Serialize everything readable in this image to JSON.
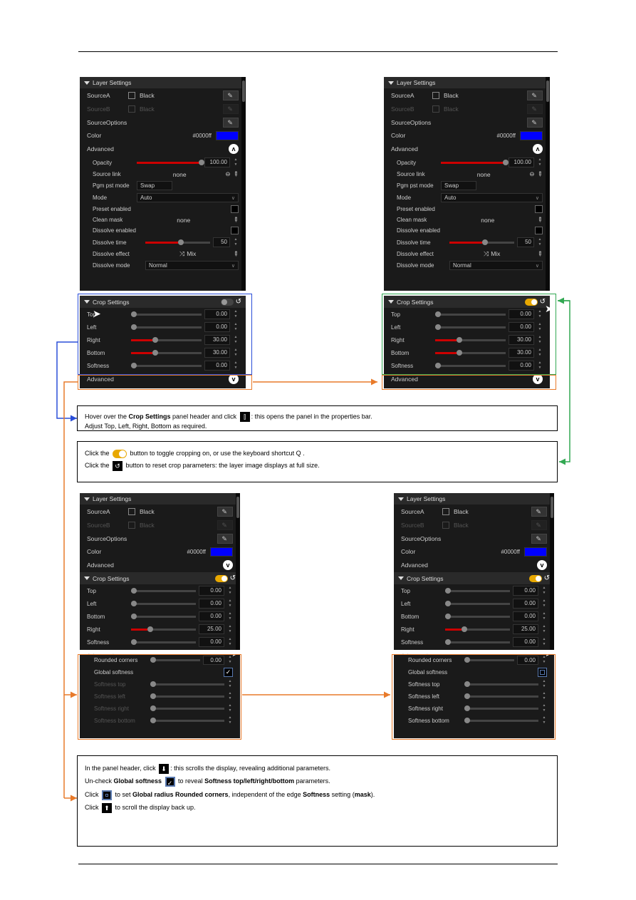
{
  "layer": {
    "title": "Layer Settings",
    "sourceA": "SourceA",
    "sourceB": "SourceB",
    "black": "Black",
    "sourceOptions": "SourceOptions",
    "color": "Color",
    "colorVal": "#0000ff",
    "advanced": "Advanced",
    "opacity": "Opacity",
    "opacityVal": "100.00",
    "sourceLink": "Source link",
    "sourceLinkVal": "none",
    "pgmPst": "Pgm pst mode",
    "swap": "Swap",
    "mode": "Mode",
    "auto": "Auto",
    "preset": "Preset enabled",
    "cleanMask": "Clean mask",
    "cleanMaskVal": "none",
    "dissolveEn": "Dissolve enabled",
    "dissolveTime": "Dissolve time",
    "dissolveTimeVal": "50",
    "dissolveEffect": "Dissolve effect",
    "mix": "Mix",
    "dissolveMode": "Dissolve mode",
    "normal": "Normal"
  },
  "crop": {
    "title": "Crop Settings",
    "top": "Top",
    "left": "Left",
    "right": "Right",
    "bottom": "Bottom",
    "softness": "Softness",
    "advanced": "Advanced",
    "zero": "0.00",
    "thirty": "30.00",
    "twentyfive": "25.00",
    "roundedCorners": "Rounded corners",
    "globalSoftness": "Global softness",
    "softnessTop": "Softness top",
    "softnessLeft": "Softness left",
    "softnessRight": "Softness right",
    "softnessBottom": "Softness bottom"
  },
  "note1": {
    "line1a": "Hover over the ",
    "line1b": " panel header and click ",
    "line1c": ": this opens the panel in the properties bar.",
    "crop": "Crop Settings",
    "line2": "Adjust Top, Left, Right, Bottom as required."
  },
  "note2": {
    "line1a": "Click the ",
    "line1b": " button to toggle cropping on, or use the keyboard shortcut  Q .",
    "line2a": "Click the ",
    "line2b": " button to reset crop parameters: the layer image displays at full size."
  },
  "note3": {
    "line1a": "In the panel header, click ",
    "line1b": ": this scrolls the display, revealing additional parameters.",
    "line2a": "Un-check ",
    "line2b": " to reveal ",
    "line2c": " parameters.",
    "globalSoftness": "Global softness",
    "softnessLbl": "Softness top/left/right/bottom",
    "line3a": "Click ",
    "line3b": " to set ",
    "line3c": ", independent of the edge ",
    "line3d": " setting (",
    "line3e": ").",
    "globalRadius": "Global radius",
    "roundedCorners": "Rounded corners",
    "softness": "Softness",
    "mask": "mask",
    "line4a": "Click ",
    "line4b": " to scroll the display back up."
  }
}
